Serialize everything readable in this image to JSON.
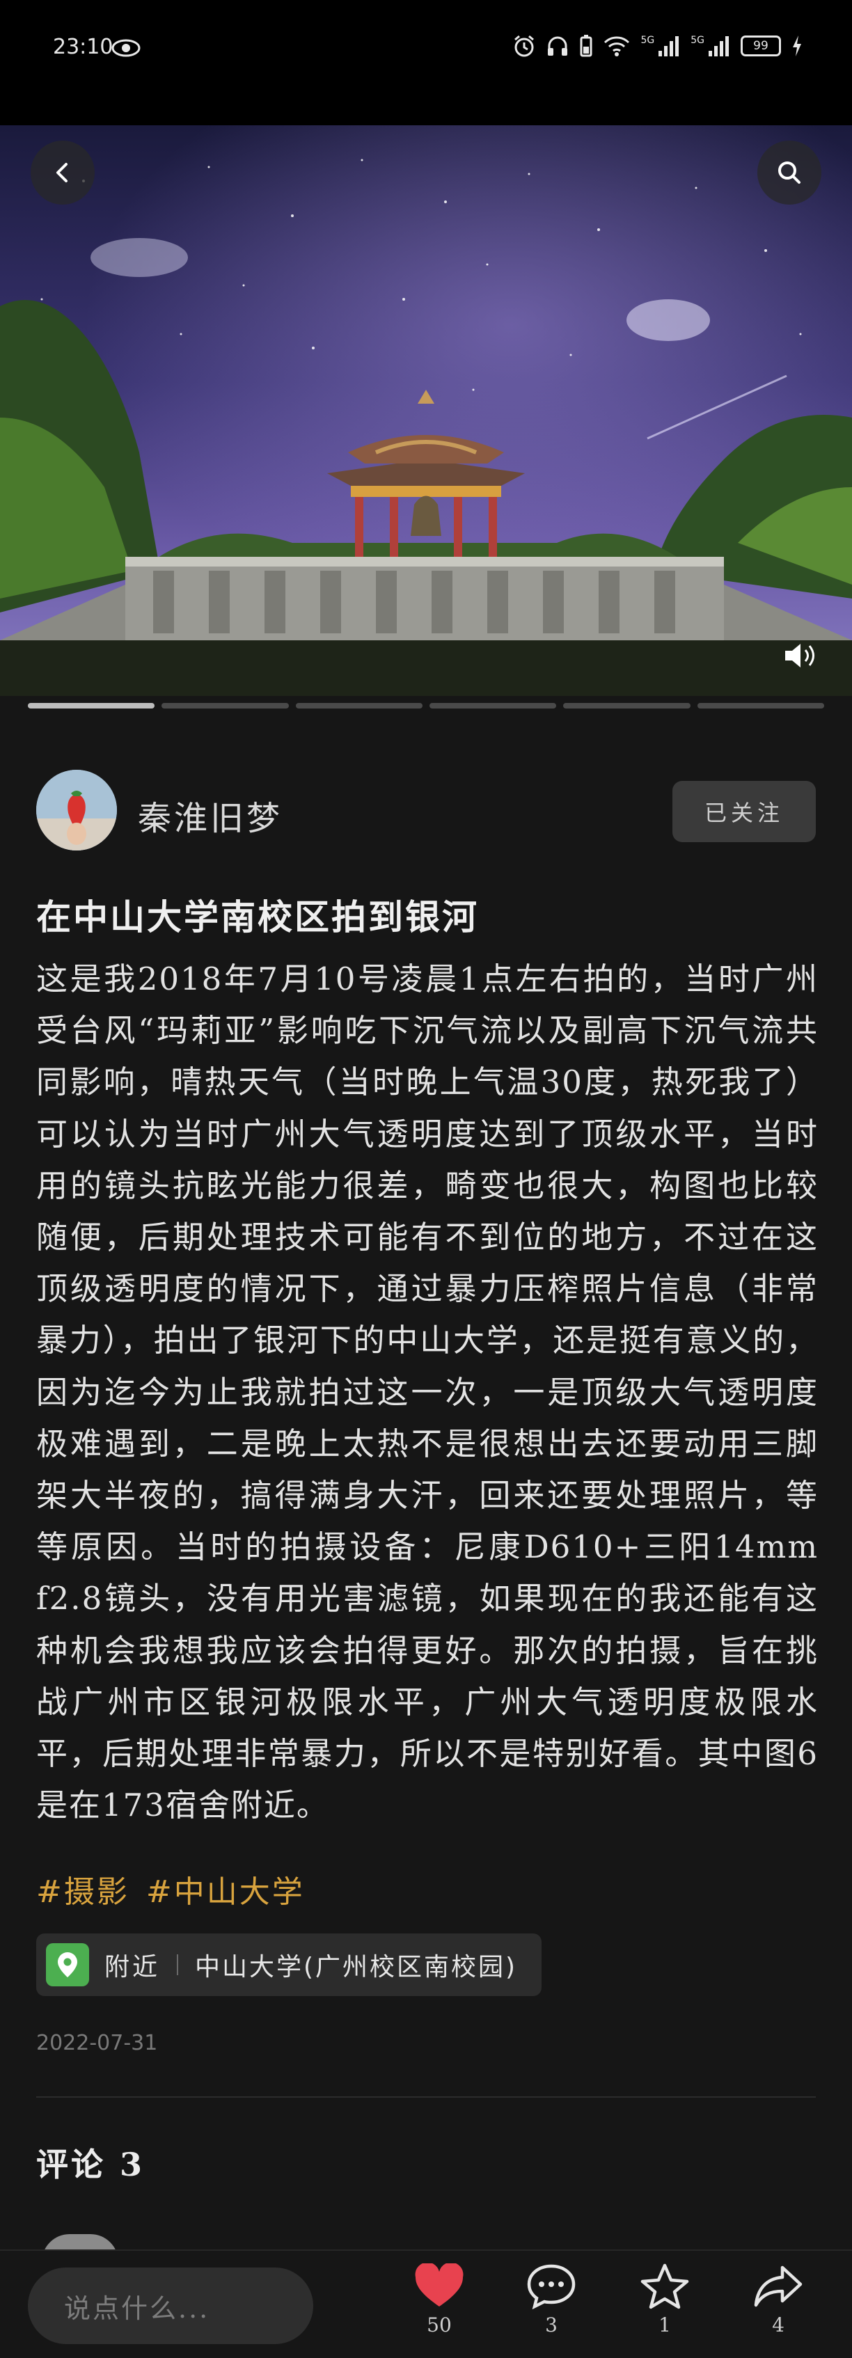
{
  "status_bar": {
    "time": "23:10",
    "network_label_1": "5G",
    "network_label_2": "5G",
    "battery": "99"
  },
  "hero": {
    "slide_count": 6,
    "active_slide": 1
  },
  "author": {
    "name": "秦淮旧梦",
    "follow_label": "已关注"
  },
  "post": {
    "title": "在中山大学南校区拍到银河",
    "body": "这是我2018年7月10号凌晨1点左右拍的，当时广州受台风“玛莉亚”影响吃下沉气流以及副高下沉气流共同影响，晴热天气（当时晚上气温30度，热死我了）可以认为当时广州大气透明度达到了顶级水平，当时用的镜头抗眩光能力很差，畸变也很大，构图也比较随便，后期处理技术可能有不到位的地方，不过在这顶级透明度的情况下，通过暴力压榨照片信息（非常暴力），拍出了银河下的中山大学，还是挺有意义的，因为迄今为止我就拍过这一次，一是顶级大气透明度极难遇到，二是晚上太热不是很想出去还要动用三脚架大半夜的，搞得满身大汗，回来还要处理照片，等等原因。当时的拍摄设备：尼康D610+三阳14mm f2.8镜头，没有用光害滤镜，如果现在的我还能有这种机会我想我应该会拍得更好。那次的拍摄，旨在挑战广州市区银河极限水平，广州大气透明度极限水平，后期处理非常暴力，所以不是特别好看。其中图6是在173宿舍附近。",
    "tags": [
      "#摄影",
      "#中山大学"
    ],
    "location_prefix": "附近",
    "location_name": "中山大学(广州校区南校园)",
    "date": "2022-07-31"
  },
  "comments": {
    "title": "评论 3"
  },
  "bottom_bar": {
    "input_placeholder": "说点什么...",
    "like_count": "50",
    "comment_count": "3",
    "star_count": "1",
    "share_count": "4"
  },
  "colors": {
    "background": "#161616",
    "accent_tag": "#d8a33e",
    "like_red": "#e8424f",
    "location_green": "#4caf50"
  },
  "icons": [
    "eye-icon",
    "alarm-icon",
    "headphones-icon",
    "battery-saver-icon",
    "wifi-icon",
    "signal-icon",
    "charging-icon",
    "back-icon",
    "search-icon",
    "volume-icon",
    "location-pin-icon",
    "heart-icon",
    "comment-bubble-icon",
    "star-icon",
    "share-icon"
  ]
}
